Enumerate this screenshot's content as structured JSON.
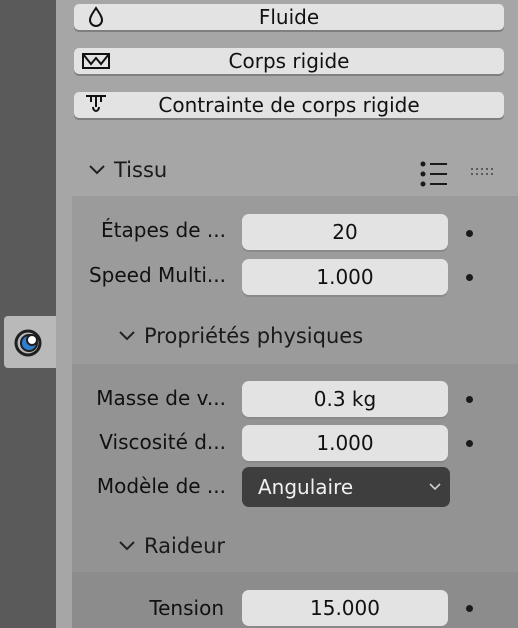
{
  "physics_buttons": [
    {
      "label": "Fluide",
      "icon": "droplet-icon"
    },
    {
      "label": "Corps rigide",
      "icon": "rigid-body-icon"
    },
    {
      "label": "Contrainte de corps rigide",
      "icon": "rigid-body-constraint-icon"
    }
  ],
  "cloth": {
    "title": "Tissu",
    "fields": [
      {
        "label": "Étapes de ...",
        "value": "20"
      },
      {
        "label": "Speed Multi...",
        "value": "1.000"
      }
    ]
  },
  "physical_properties": {
    "title": "Propriétés physiques",
    "fields": [
      {
        "label": "Masse de v...",
        "value": "0.3 kg"
      },
      {
        "label": "Viscosité d...",
        "value": "1.000"
      }
    ],
    "model": {
      "label": "Modèle de ...",
      "value": "Angulaire"
    }
  },
  "stiffness": {
    "title": "Raideur",
    "fields": [
      {
        "label": "Tension",
        "value": "15.000"
      }
    ]
  },
  "colors": {
    "panel": "#a6a6a6",
    "subpanel": "#999999",
    "subpanel_inner": "#8f8f8f",
    "field": "#e3e3e3",
    "dropdown": "#3e3e3e",
    "tab_icon_blue": "#2f7fd0"
  }
}
